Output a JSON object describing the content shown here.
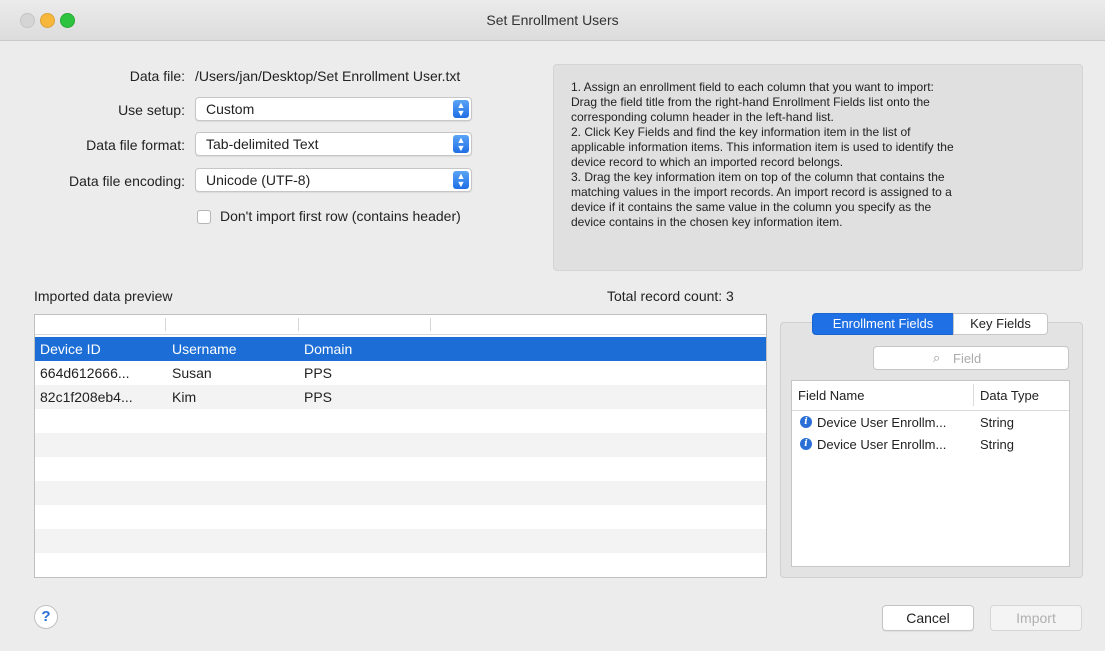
{
  "window": {
    "title": "Set Enrollment Users"
  },
  "form": {
    "data_file_label": "Data file:",
    "data_file_value": "/Users/jan/Desktop/Set Enrollment User.txt",
    "use_setup_label": "Use setup:",
    "use_setup_value": "Custom",
    "format_label": "Data file format:",
    "format_value": "Tab-delimited Text",
    "encoding_label": "Data file encoding:",
    "encoding_value": "Unicode (UTF-8)",
    "first_row_label": "Don't import first row (contains header)",
    "first_row_checked": false
  },
  "instructions": [
    "1. Assign an enrollment field to each column that you want to import:",
    "Drag the field title from the right-hand Enrollment Fields list onto the",
    "corresponding column header in the left-hand list.",
    "2. Click Key Fields and find the key information item in the list of",
    "applicable information items. This information item is used to identify the",
    "device record to which an imported record belongs.",
    "3. Drag the key information item on top of the column that contains the",
    "matching values in the import records. An import record is assigned to a",
    "device if it contains the same value in the column you specify as the",
    "device contains in the chosen key information item."
  ],
  "preview": {
    "title": "Imported data preview",
    "total_label": "Total record count: 3",
    "rows": [
      [
        "Device ID",
        "Username",
        "Domain"
      ],
      [
        "664d612666...",
        "Susan",
        "PPS"
      ],
      [
        "82c1f208eb4...",
        "Kim",
        "PPS"
      ]
    ]
  },
  "fields_panel": {
    "tab_enrollment": "Enrollment Fields",
    "tab_key": "Key Fields",
    "search_placeholder": "Field",
    "col_name": "Field Name",
    "col_type": "Data Type",
    "rows": [
      {
        "name": "Device User Enrollm...",
        "type": "String"
      },
      {
        "name": "Device User Enrollm...",
        "type": "String"
      }
    ]
  },
  "buttons": {
    "help": "?",
    "cancel": "Cancel",
    "import": "Import"
  },
  "colors": {
    "accent": "#1f6fe5",
    "selection": "#1c6ed6"
  }
}
